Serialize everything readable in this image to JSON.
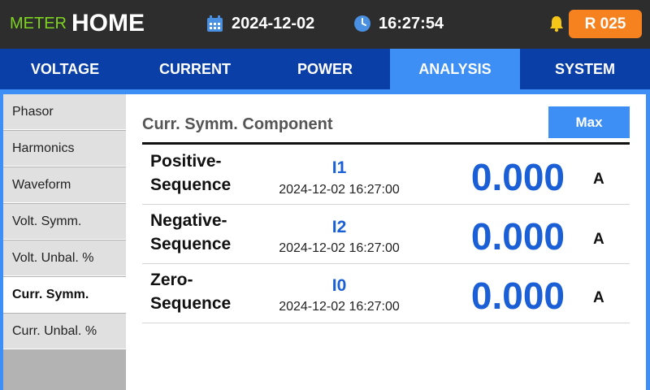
{
  "header": {
    "meter_label": "METER",
    "home_label": "HOME",
    "date": "2024-12-02",
    "time": "16:27:54",
    "badge": "R 025",
    "icons": {
      "calendar": "calendar-icon",
      "clock": "clock-icon",
      "bell": "bell-icon"
    },
    "colors": {
      "meter_label": "#7ed321",
      "badge": "#f5821f",
      "bell": "#f5c518"
    }
  },
  "tabs": [
    {
      "label": "VOLTAGE",
      "active": false
    },
    {
      "label": "CURRENT",
      "active": false
    },
    {
      "label": "POWER",
      "active": false
    },
    {
      "label": "ANALYSIS",
      "active": true
    },
    {
      "label": "SYSTEM",
      "active": false
    }
  ],
  "sidebar": {
    "items": [
      {
        "label": "Phasor",
        "active": false
      },
      {
        "label": "Harmonics",
        "active": false
      },
      {
        "label": "Waveform",
        "active": false
      },
      {
        "label": "Volt. Symm.",
        "active": false
      },
      {
        "label": "Volt. Unbal. %",
        "active": false
      },
      {
        "label": "Curr. Symm.",
        "active": true
      },
      {
        "label": "Curr. Unbal. %",
        "active": false
      }
    ]
  },
  "panel": {
    "title": "Curr. Symm. Component",
    "max_button": "Max",
    "rows": [
      {
        "name_line1": "Positive-",
        "name_line2": "Sequence",
        "code": "I1",
        "timestamp": "2024-12-02 16:27:00",
        "value": "0.000",
        "unit": "A"
      },
      {
        "name_line1": "Negative-",
        "name_line2": "Sequence",
        "code": "I2",
        "timestamp": "2024-12-02 16:27:00",
        "value": "0.000",
        "unit": "A"
      },
      {
        "name_line1": "Zero-",
        "name_line2": "Sequence",
        "code": "I0",
        "timestamp": "2024-12-02 16:27:00",
        "value": "0.000",
        "unit": "A"
      }
    ]
  },
  "theme": {
    "topbar": "#2d2d2d",
    "tabbar": "#0a3fa8",
    "accent": "#3d8ef5",
    "value_color": "#1a5fd6"
  }
}
